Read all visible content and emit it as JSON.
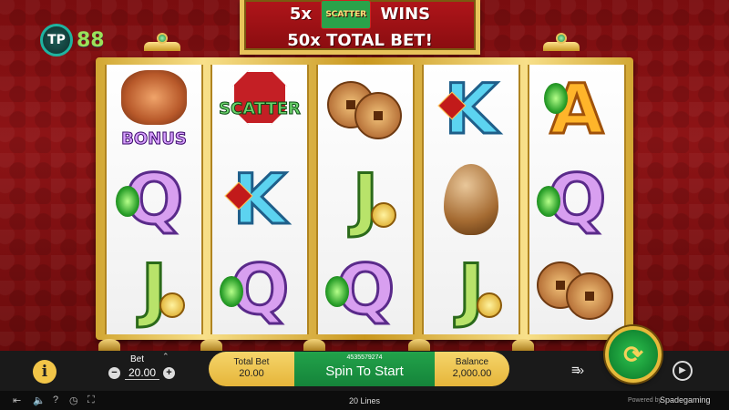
{
  "brand_logo": {
    "mark": "TP",
    "text": "88"
  },
  "banner": {
    "line1_prefix": "5x",
    "scatter_badge": "SCATTER",
    "line1_suffix": "WINS",
    "line2": "50x TOTAL BET!"
  },
  "reels": [
    [
      "bonus",
      "Q",
      "J"
    ],
    [
      "scatter",
      "K",
      "Q"
    ],
    [
      "coins",
      "J",
      "Q"
    ],
    [
      "K",
      "egg",
      "J"
    ],
    [
      "A",
      "Q",
      "coins"
    ]
  ],
  "symbols": {
    "scatter_text": "SCATTER",
    "bonus_text": "BONUS"
  },
  "controls": {
    "info_label": "i",
    "bet_label": "Bet",
    "bet_value": "20.00",
    "minus": "−",
    "plus": "+",
    "total_bet_label": "Total Bet",
    "total_bet_value": "20.00",
    "spin_id": "4535579274",
    "spin_label": "Spin To Start",
    "balance_label": "Balance",
    "balance_value": "2,000.00"
  },
  "footer": {
    "lines": "20 Lines",
    "powered_by": "Powered by",
    "provider": "Spadegaming"
  },
  "colors": {
    "frame_gold": "#e8c35a",
    "spin_green": "#1a9a42",
    "background_red": "#8e1416"
  }
}
